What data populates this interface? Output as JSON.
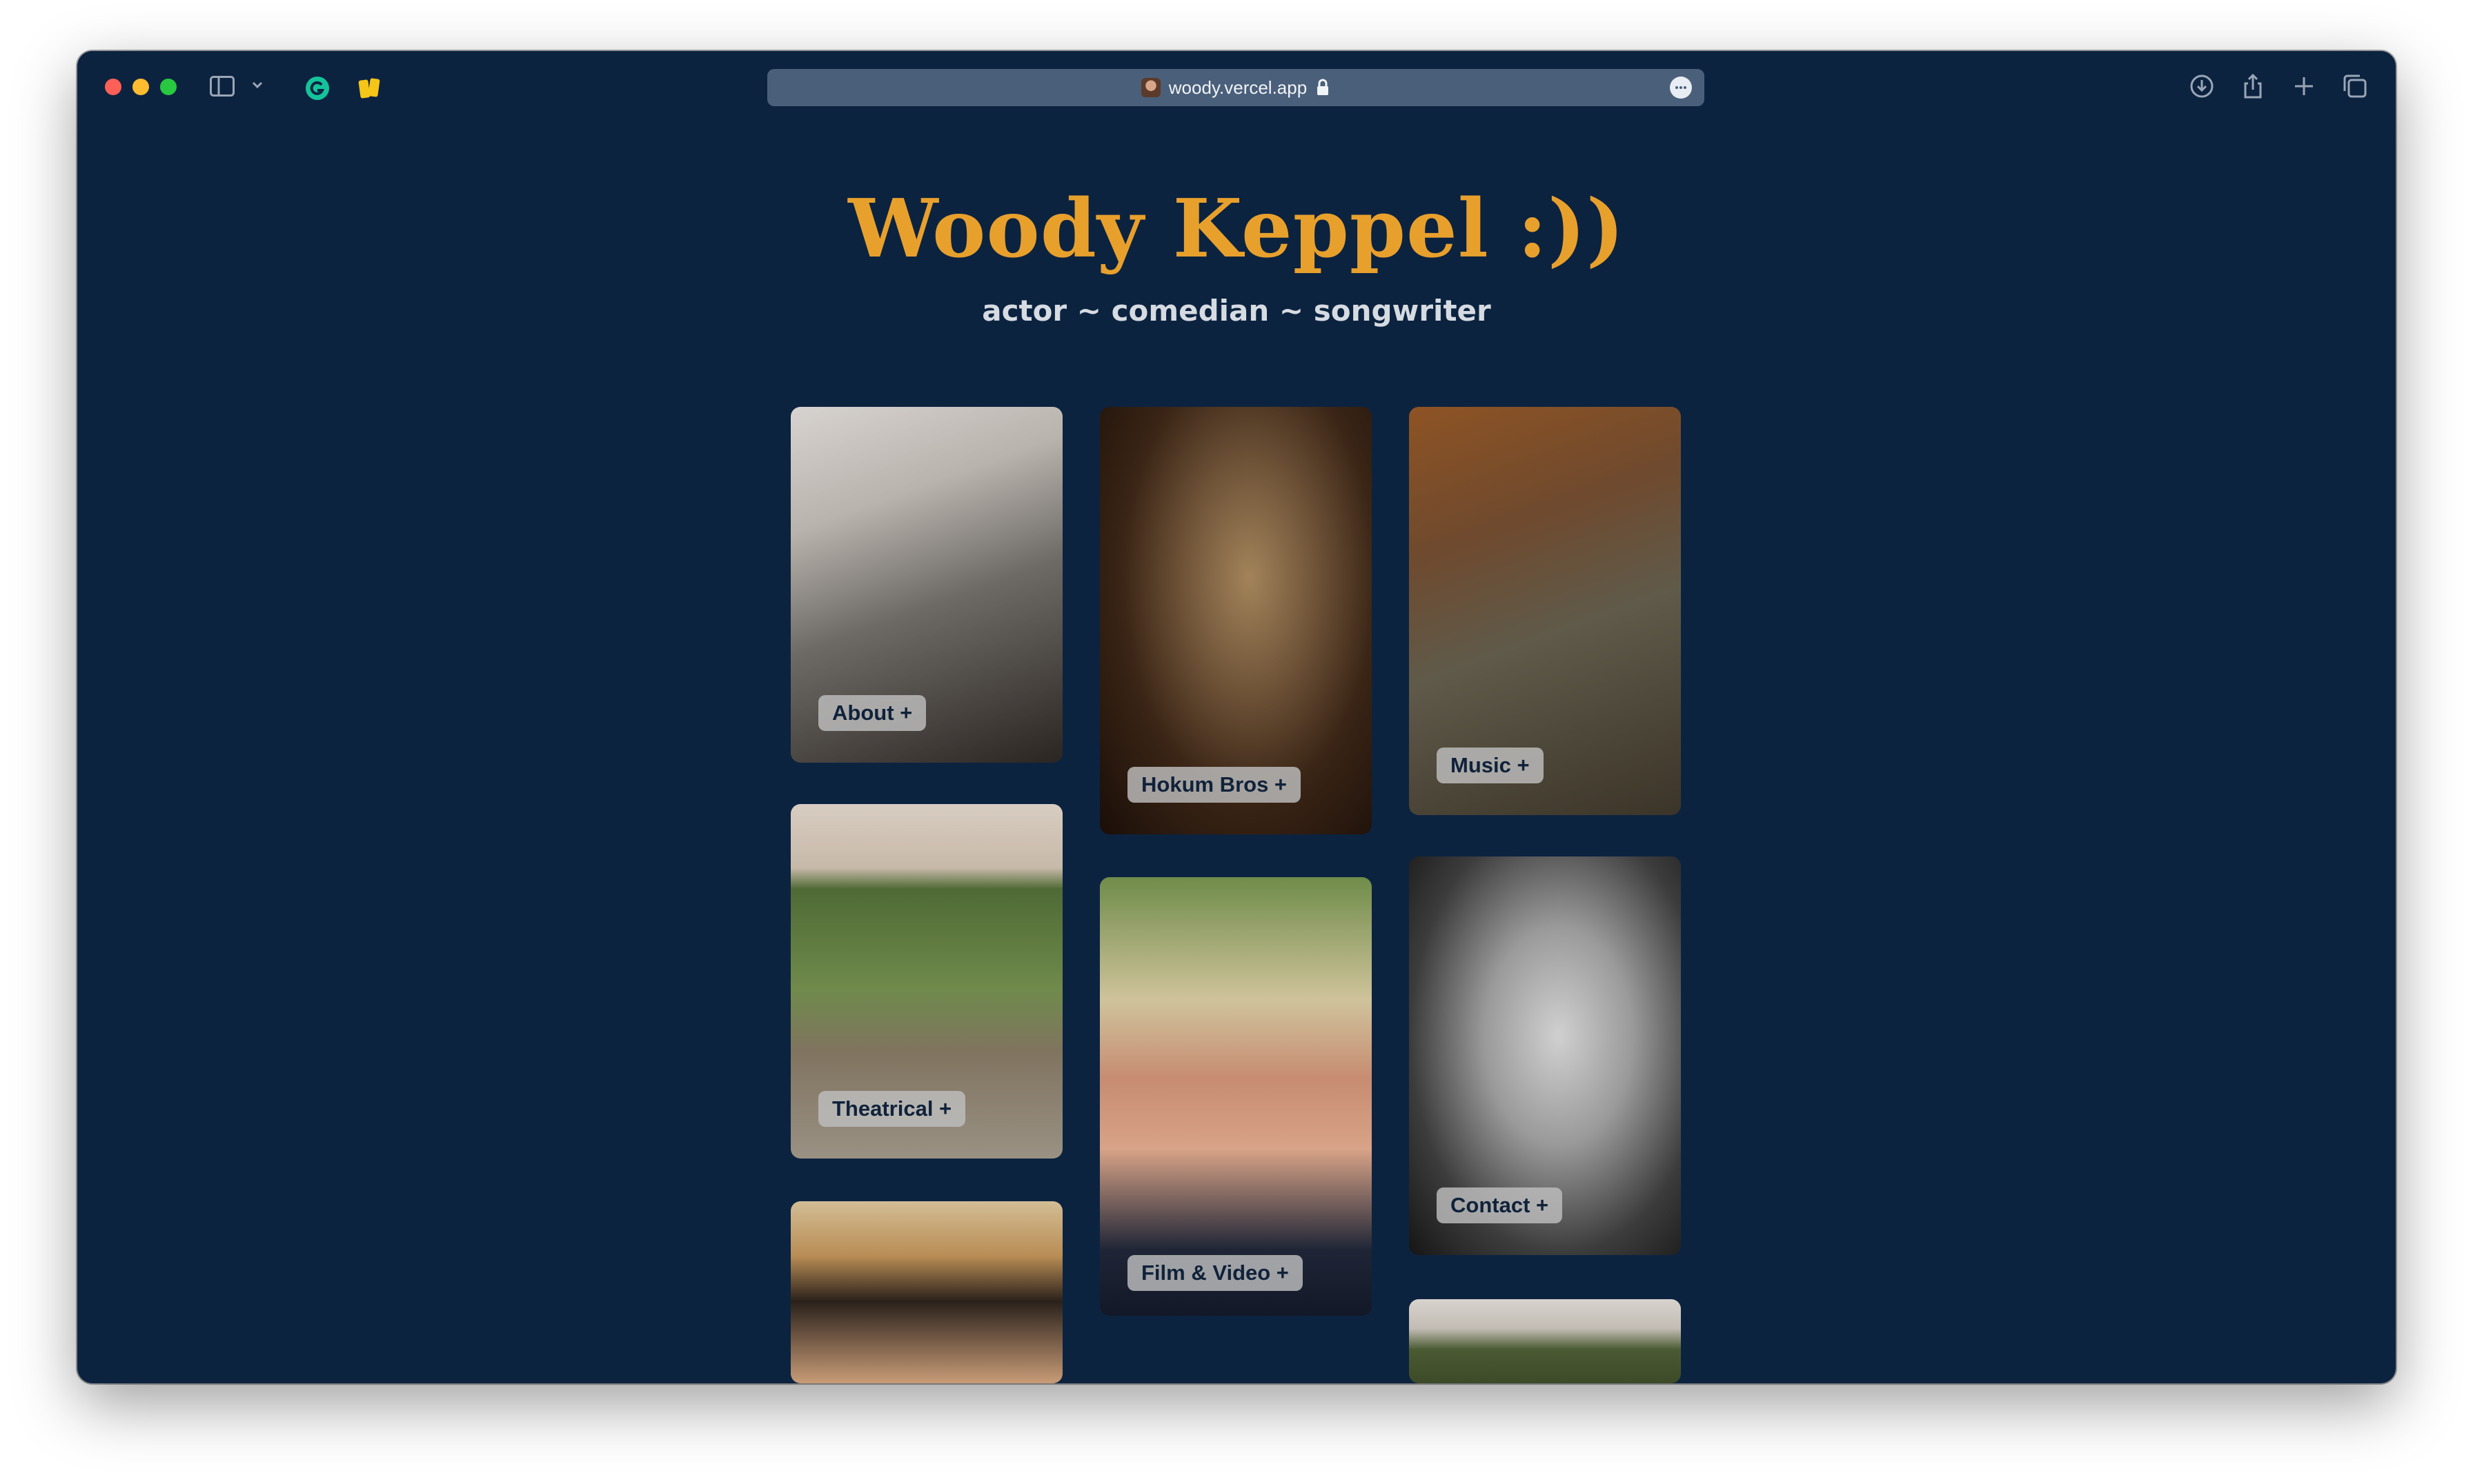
{
  "browser": {
    "url": "woody.vercel.app",
    "icons": {
      "sidebar": "sidebar-icon",
      "chevron": "chevron-down-icon",
      "extension1": "grammarly-icon",
      "extension2": "notes-icon",
      "lock": "lock-icon",
      "reader": "more-icon",
      "download": "download-icon",
      "share": "share-icon",
      "new_tab": "plus-icon",
      "tabs": "tabs-icon"
    }
  },
  "site": {
    "title": "Woody Keppel :))",
    "subtitle": "actor ~ comedian ~ songwriter",
    "colors": {
      "background": "#0c2340",
      "title": "#e8a02c",
      "label_bg": "#bebebe"
    }
  },
  "cards": [
    {
      "label": "About +"
    },
    {
      "label": "Theatrical +"
    },
    {
      "label": ""
    },
    {
      "label": "Hokum Bros +"
    },
    {
      "label": "Film & Video +"
    },
    {
      "label": "Music +"
    },
    {
      "label": "Contact +"
    },
    {
      "label": ""
    }
  ]
}
